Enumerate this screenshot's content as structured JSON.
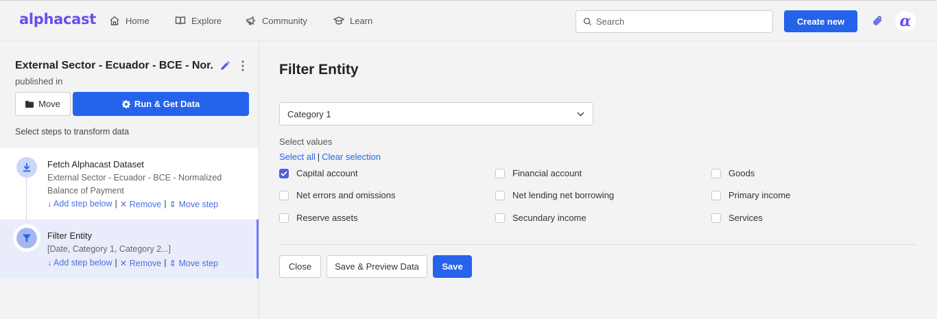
{
  "header": {
    "logo": "alphacast",
    "nav": [
      {
        "label": "Home",
        "icon": "home-icon"
      },
      {
        "label": "Explore",
        "icon": "book-icon"
      },
      {
        "label": "Community",
        "icon": "megaphone-icon"
      },
      {
        "label": "Learn",
        "icon": "graduation-cap-icon"
      }
    ],
    "search_placeholder": "Search",
    "create_label": "Create new",
    "avatar_glyph": "α"
  },
  "workflow": {
    "title": "External Sector - Ecuador - BCE - Nor...",
    "published": "published in",
    "move_label": "Move",
    "run_label": "Run & Get Data",
    "hint": "Select steps to transform data"
  },
  "steps": [
    {
      "name": "Fetch Alphacast Dataset",
      "desc": "External Sector - Ecuador - BCE - Normalized Balance of Payment",
      "add": "↓ Add step below",
      "remove": "✕ Remove",
      "move": "⇕ Move step"
    },
    {
      "name": "Filter Entity",
      "desc": "[Date, Category 1, Category 2...]",
      "add": "↓ Add step below",
      "remove": "✕ Remove",
      "move": "⇕ Move step"
    }
  ],
  "filter": {
    "title": "Filter Entity",
    "selected_column": "Category 1",
    "values_label": "Select values",
    "select_all": "Select all",
    "clear_selection": "Clear selection",
    "options": [
      {
        "label": "Capital account",
        "checked": true
      },
      {
        "label": "Financial account",
        "checked": false
      },
      {
        "label": "Goods",
        "checked": false
      },
      {
        "label": "Net errors and omissions",
        "checked": false
      },
      {
        "label": "Net lending net borrowing",
        "checked": false
      },
      {
        "label": "Primary income",
        "checked": false
      },
      {
        "label": "Reserve assets",
        "checked": false
      },
      {
        "label": "Secundary income",
        "checked": false
      },
      {
        "label": "Services",
        "checked": false
      }
    ],
    "close_label": "Close",
    "preview_label": "Save & Preview Data",
    "save_label": "Save"
  },
  "colors": {
    "brand": "#6a4cf2",
    "primary": "#2563eb",
    "link": "#4a6ee0"
  }
}
